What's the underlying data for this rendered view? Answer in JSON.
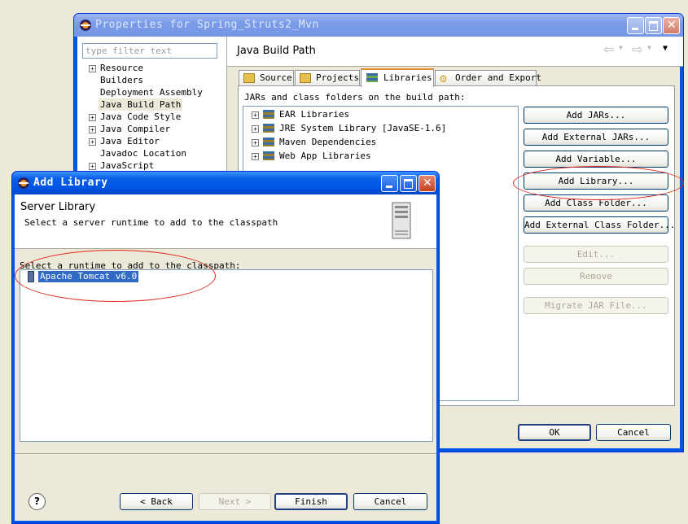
{
  "props": {
    "title": "Properties for Spring_Struts2_Mvn",
    "filter_placeholder": "type filter text",
    "nav_items": [
      "Resource",
      "Builders",
      "Deployment Assembly",
      "Java Build Path",
      "Java Code Style",
      "Java Compiler",
      "Java Editor",
      "Javadoc Location",
      "JavaScript"
    ],
    "page_title": "Java Build Path",
    "tabs": [
      "Source",
      "Projects",
      "Libraries",
      "Order and Export"
    ],
    "libs_label": "JARs and class folders on the build path:",
    "libs": [
      "EAR Libraries",
      "JRE System Library [JavaSE-1.6]",
      "Maven Dependencies",
      "Web App Libraries"
    ],
    "side_buttons": [
      "Add JARs...",
      "Add External JARs...",
      "Add Variable...",
      "Add Library...",
      "Add Class Folder...",
      "Add External Class Folder...",
      "Edit...",
      "Remove",
      "Migrate JAR File..."
    ],
    "ok": "OK",
    "cancel": "Cancel"
  },
  "addlib": {
    "title": "Add Library",
    "heading": "Server Library",
    "description": "Select a server runtime to add to the classpath",
    "list_label": "Select a runtime to add to the classpath:",
    "runtimes": [
      "Apache Tomcat v6.0"
    ],
    "back": "< Back",
    "next": "Next >",
    "finish": "Finish",
    "cancel": "Cancel",
    "help_icon": "?"
  },
  "colors": {
    "selection": "#316ac5",
    "annotation": "#e0281c"
  }
}
